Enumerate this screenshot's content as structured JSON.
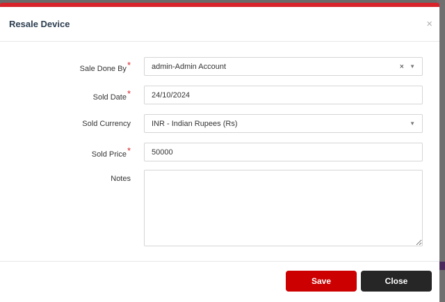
{
  "modal": {
    "title": "Resale Device",
    "close_icon": "×"
  },
  "form": {
    "sale_done_by": {
      "label": "Sale Done By",
      "value": "admin-Admin Account",
      "required": "*"
    },
    "sold_date": {
      "label": "Sold Date",
      "value": "24/10/2024",
      "required": "*"
    },
    "sold_currency": {
      "label": "Sold Currency",
      "value": "INR - Indian Rupees (Rs)"
    },
    "sold_price": {
      "label": "Sold Price",
      "value": "50000",
      "required": "*"
    },
    "notes": {
      "label": "Notes",
      "value": ""
    }
  },
  "icons": {
    "clear": "×",
    "caret": "▼"
  },
  "footer": {
    "save_label": "Save",
    "close_label": "Close"
  },
  "colors": {
    "accent": "#d8232a",
    "save": "#cc0000",
    "close": "#262626"
  }
}
